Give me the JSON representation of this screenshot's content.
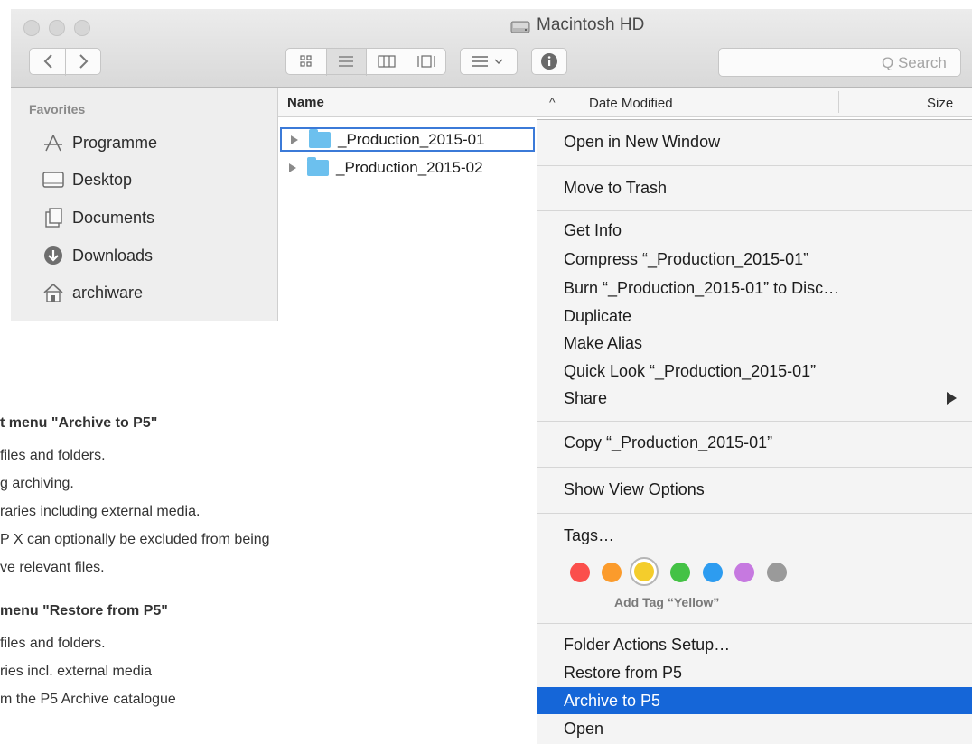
{
  "window": {
    "title": "Macintosh HD"
  },
  "toolbar": {
    "search_placeholder": "Q Search"
  },
  "sidebar": {
    "heading": "Favorites",
    "items": [
      {
        "label": "Programme",
        "icon": "applications-icon"
      },
      {
        "label": "Desktop",
        "icon": "desktop-icon"
      },
      {
        "label": "Documents",
        "icon": "documents-icon"
      },
      {
        "label": "Downloads",
        "icon": "downloads-icon"
      },
      {
        "label": "archiware",
        "icon": "home-icon"
      }
    ]
  },
  "columns": {
    "name": "Name",
    "date": "Date Modified",
    "size": "Size"
  },
  "files": [
    {
      "name": "_Production_2015-01",
      "selected": true
    },
    {
      "name": "_Production_2015-02",
      "selected": false
    }
  ],
  "notes": [
    "t menu \"Archive to P5\"",
    "files and folders.",
    "g archiving.",
    "raries including external media.",
    "P X can optionally be excluded from being",
    "ve relevant files.",
    "menu \"Restore from P5\"",
    "files and folders.",
    "ries incl. external media",
    "m the P5 Archive catalogue"
  ],
  "menu": {
    "open_new_window": "Open in New Window",
    "move_to_trash": "Move to Trash",
    "get_info": "Get Info",
    "compress": "Compress “_Production_2015-01”",
    "burn": "Burn “_Production_2015-01” to Disc…",
    "duplicate": "Duplicate",
    "make_alias": "Make Alias",
    "quick_look": "Quick Look “_Production_2015-01”",
    "share": "Share",
    "copy": "Copy “_Production_2015-01”",
    "show_view_options": "Show View Options",
    "tags": "Tags…",
    "add_tag": "Add Tag “Yellow”",
    "folder_actions": "Folder Actions Setup…",
    "restore": "Restore from P5",
    "archive": "Archive to P5",
    "open": "Open"
  },
  "tag_colors": [
    "#fb4f4c",
    "#fb9b2c",
    "#f4cd2c",
    "#44c245",
    "#2d9cf0",
    "#c679e0",
    "#9a9a9a"
  ],
  "highlight_color": "#1566d8"
}
